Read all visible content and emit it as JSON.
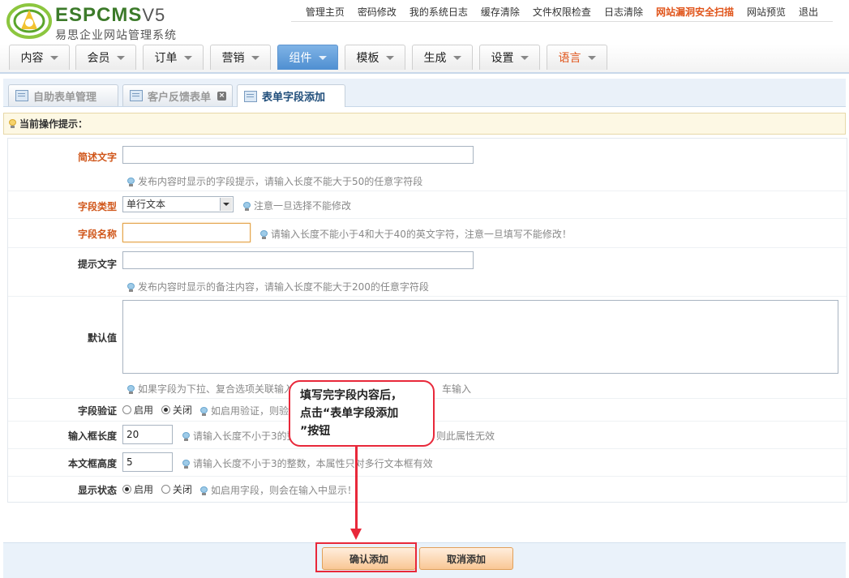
{
  "brand": {
    "logo_text": "ESPCMS",
    "logo_version": "V5",
    "subtitle": "易思企业网站管理系统",
    "color": "#3c7a2a"
  },
  "top_links": [
    "管理主页",
    "密码修改",
    "我的系统日志",
    "缓存清除",
    "文件权限检查",
    "日志清除",
    "网站漏洞安全扫描",
    "网站预览",
    "退出"
  ],
  "main_nav": [
    "内容",
    "会员",
    "订单",
    "营销",
    "组件",
    "模板",
    "生成",
    "设置",
    "语言"
  ],
  "sub_tabs": [
    "自助表单管理",
    "客户反馈表单",
    "表单字段添加"
  ],
  "tip": "当前操作提示：",
  "form": {
    "desc_label": "简述文字",
    "desc_value": "",
    "desc_hint": "发布内容时显示的字段提示，请输入长度不能大于50的任意字符段",
    "type_label": "字段类型",
    "type_value": "单行文本",
    "type_hint": "注意一旦选择不能修改",
    "name_label": "字段名称",
    "name_value": "",
    "name_hint": "请输入长度不能小于4和大于40的英文字符，注意一旦填写不能修改！",
    "tip_label": "提示文字",
    "tip_value": "",
    "tip_hint": "发布内容时显示的备注内容，请输入长度不能大于200的任意字符段",
    "default_label": "默认值",
    "default_value": "",
    "default_hint_a": "如果字段为下拉、复合选项关联输入",
    "default_hint_b": "车输入",
    "validate_label": "字段验证",
    "opt_enable": "启用",
    "opt_disable": "关闭",
    "validate_hint": "如启用验证，则验证",
    "inputlen_label": "输入框长度",
    "inputlen_value": "20",
    "inputlen_hint_a": "请输入长度不小于3的整",
    "inputlen_hint_b": "则此属性无效",
    "textheight_label": "本文框高度",
    "textheight_value": "5",
    "textheight_hint": "请输入长度不小于3的整数，本属性只对多行文本框有效",
    "display_label": "显示状态",
    "display_hint": "如启用字段，则会在输入中显示！"
  },
  "callout": {
    "line1": "填写完字段内容后，",
    "line2": "点击“表单字段添加",
    "line3": "”按钮"
  },
  "buttons": {
    "confirm": "确认添加",
    "cancel": "取消添加"
  },
  "colors": {
    "accent": "#4f8fd1",
    "highlight": "#e0541a",
    "callout": "#e8283a"
  }
}
